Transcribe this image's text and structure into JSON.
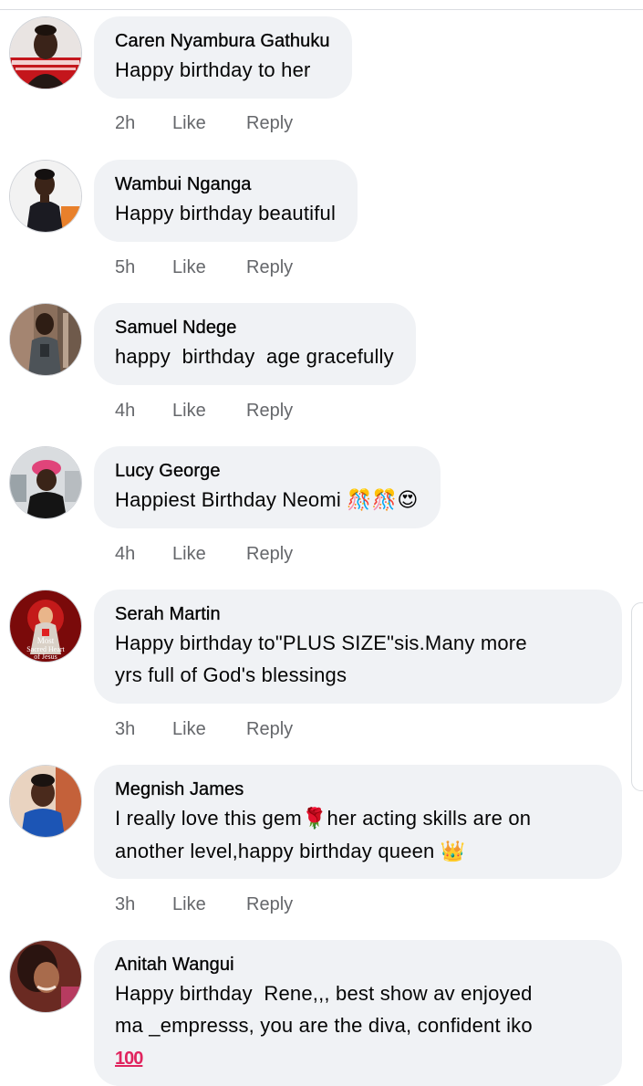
{
  "comments": [
    {
      "author": "Caren Nyambura Gathuku",
      "text": "Happy birthday to her",
      "time": "2h",
      "like": "Like",
      "reply": "Reply",
      "avatar": "avatar-caren"
    },
    {
      "author": "Wambui Nganga",
      "text": "Happy birthday beautiful",
      "time": "5h",
      "like": "Like",
      "reply": "Reply",
      "avatar": "avatar-wambui"
    },
    {
      "author": "Samuel Ndege",
      "text": "happy  birthday  age gracefully",
      "time": "4h",
      "like": "Like",
      "reply": "Reply",
      "avatar": "avatar-samuel"
    },
    {
      "author": "Lucy George",
      "text": "Happiest Birthday Neomi ",
      "emoji": "🎊🎊😍",
      "time": "4h",
      "like": "Like",
      "reply": "Reply",
      "avatar": "avatar-lucy"
    },
    {
      "author": "Serah Martin",
      "text_line1": "Happy birthday to\"PLUS SIZE\"sis.Many more",
      "text_line2": "yrs full of God's blessings",
      "time": "3h",
      "like": "Like",
      "reply": "Reply",
      "avatar": "avatar-serah",
      "avatar_text_1": "Most",
      "avatar_text_2": "Sacred Heart",
      "avatar_text_3": "of Jesus"
    },
    {
      "author": "Megnish James",
      "text_line1_a": "I really love this gem",
      "text_line1_emoji": "🌹",
      "text_line1_b": "her acting skills are on",
      "text_line2": "another level,happy birthday queen ",
      "text_line2_emoji": "👑",
      "time": "3h",
      "like": "Like",
      "reply": "Reply",
      "avatar": "avatar-megnish"
    },
    {
      "author": "Anitah Wangui",
      "text_line1": "Happy birthday  Rene,,, best show av enjoyed",
      "text_line2": "ma _empresss, you are the diva, confident iko",
      "text_line3_emoji": "100",
      "avatar": "avatar-anitah"
    }
  ],
  "colors": {
    "bubble": "#f0f2f5",
    "meta_text": "#65676b",
    "name_text": "#050505"
  }
}
